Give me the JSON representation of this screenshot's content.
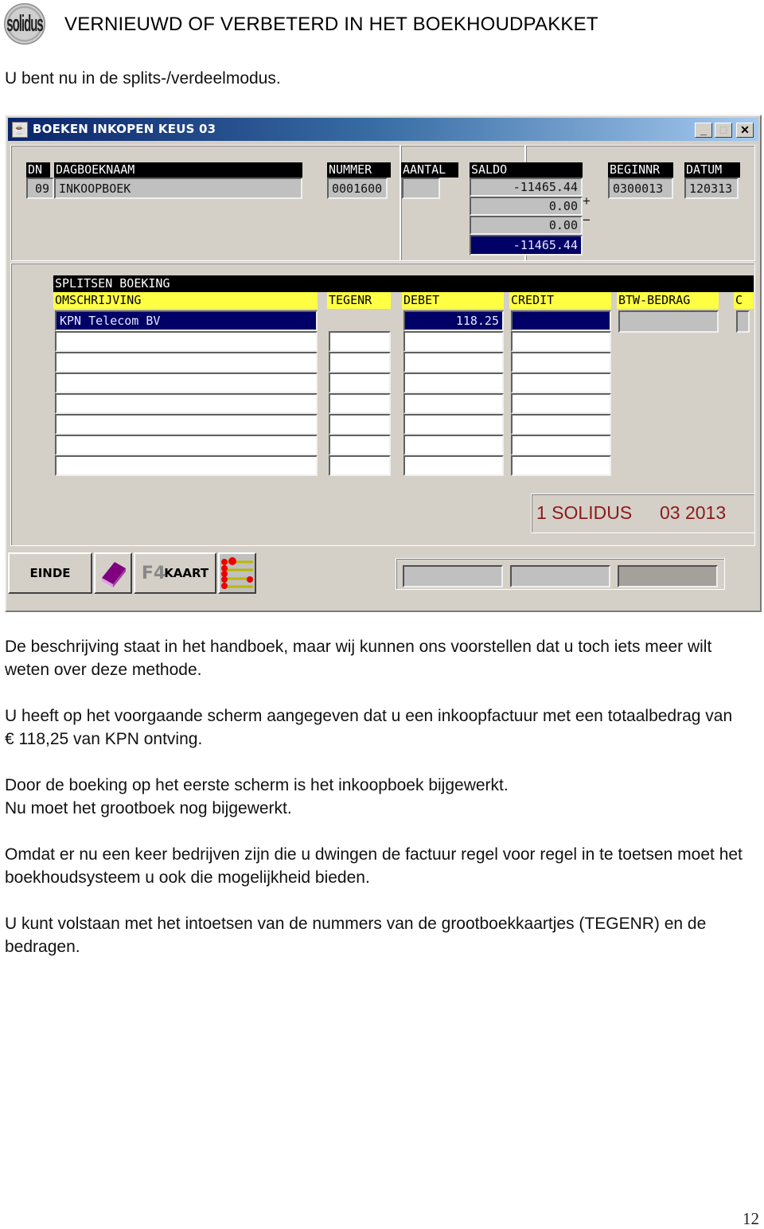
{
  "document": {
    "logo_text": "solidus",
    "title": "VERNIEUWD OF VERBETERD IN HET BOEKHOUDPAKKET",
    "intro": "U bent nu in de splits-/verdeelmodus.",
    "paragraphs": [
      "De beschrijving staat in het handboek, maar wij kunnen ons voorstellen dat u toch iets meer wilt weten over deze methode.",
      "U heeft op het voorgaande scherm aangegeven dat u een inkoopfactuur met een totaalbedrag van € 118,25 van KPN ontving.",
      "Door de boeking op het eerste scherm is het inkoopboek bijgewerkt.\nNu moet het grootboek nog bijgewerkt.",
      "Omdat er nu een keer bedrijven zijn die u dwingen de factuur regel voor regel in te toetsen moet het boekhoudsysteem u ook die mogelijkheid bieden.",
      "U kunt volstaan met het intoetsen van de nummers van de grootboekkaartjes (TEGENR) en de bedragen."
    ],
    "page_number": "12"
  },
  "window": {
    "title": "BOEKEN INKOPEN KEUS 03",
    "controls": {
      "minimize": "_",
      "maximize": "□",
      "close": "✕"
    },
    "header": {
      "dn_label": "DN",
      "dn_value": "09",
      "dagboeknaam_label": "DAGBOEKNAAM",
      "dagboeknaam_value": "INKOOPBOEK",
      "nummer_label": "NUMMER",
      "nummer_value": "0001600",
      "aantal_label": "AANTAL",
      "aantal_value": "",
      "saldo_label": "SALDO",
      "saldo_values": [
        "-11465.44",
        "0.00",
        "0.00",
        "-11465.44"
      ],
      "saldo_plus": "+",
      "saldo_minus": "−",
      "beginnr_label": "BEGINNR",
      "beginnr_value": "0300013",
      "datum_label": "DATUM",
      "datum_value": "120313"
    },
    "split": {
      "section_title": "SPLITSEN BOEKING",
      "columns": [
        "OMSCHRIJVING",
        "TEGENR",
        "DEBET",
        "CREDIT",
        "BTW-BEDRAG",
        "C"
      ],
      "first_row": {
        "omschrijving": "KPN Telecom BV",
        "debet": "118.25",
        "credit": "",
        "btw": "",
        "c": ""
      },
      "empty_rows": 7
    },
    "status": {
      "company": "1 SOLIDUS",
      "period": "03 2013"
    },
    "buttons": {
      "einde": "EINDE",
      "kaart_prefix": "F4",
      "kaart": "KAART"
    }
  }
}
